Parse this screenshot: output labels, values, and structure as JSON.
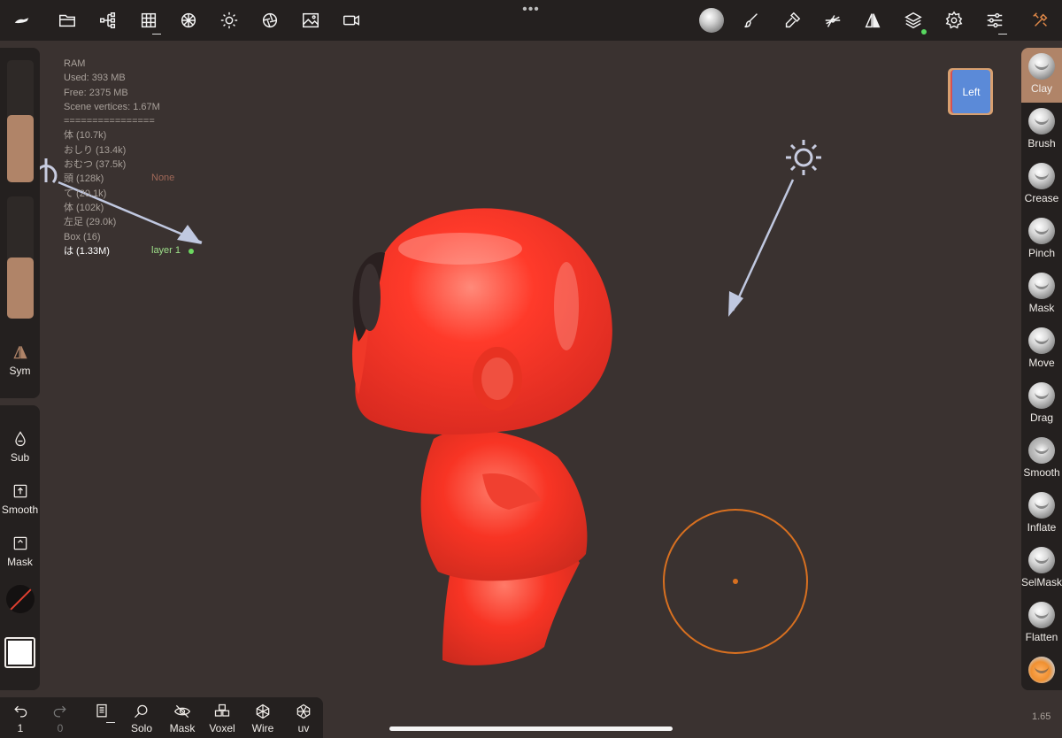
{
  "toolbar": {
    "left_icons": [
      "scene-icon",
      "folder-icon",
      "scene-tree-icon",
      "grid-icon",
      "topology-icon",
      "light-icon",
      "camera-aperture-icon",
      "background-image-icon",
      "video-record-icon"
    ],
    "right_icons": [
      "material-ball-icon",
      "paint-brush-icon",
      "stroke-icon",
      "gizmo-icon",
      "symmetry-icon",
      "layers-icon",
      "settings-icon",
      "tool-settings-icon",
      "interface-icon"
    ],
    "more_dots": "•••"
  },
  "stats": {
    "lines": [
      "RAM",
      "Used: 393 MB",
      "Free: 2375 MB",
      "Scene vertices: 1.67M",
      "================",
      "体 (10.7k)",
      "おしり (13.4k)",
      "おむつ (37.5k)",
      "頭 (128k)",
      "て (20.1k)",
      "体 (102k)",
      "左足 (29.0k)",
      "Box (16)",
      "は (1.33M)"
    ],
    "none_label": "None",
    "layer_label": "layer 1"
  },
  "left_panel": {
    "slider_radius_fill": 0.55,
    "slider_intensity_fill": 0.5,
    "sym_label": "Sym",
    "sub_label": "Sub",
    "smooth_label": "Smooth",
    "mask_label": "Mask"
  },
  "view_cube": {
    "face_label": "Left"
  },
  "tools": [
    {
      "label": "Clay",
      "active": true
    },
    {
      "label": "Brush",
      "active": false
    },
    {
      "label": "Crease",
      "active": false
    },
    {
      "label": "Pinch",
      "active": false
    },
    {
      "label": "Mask",
      "active": false
    },
    {
      "label": "Move",
      "active": false
    },
    {
      "label": "Drag",
      "active": false
    },
    {
      "label": "Smooth",
      "active": false
    },
    {
      "label": "Inflate",
      "active": false
    },
    {
      "label": "SelMask",
      "active": false
    },
    {
      "label": "Flatten",
      "active": false
    }
  ],
  "bottom_bar": {
    "undo_count": "1",
    "redo_count": "0",
    "solo_label": "Solo",
    "mask_label": "Mask",
    "voxel_label": "Voxel",
    "wire_label": "Wire",
    "uv_label": "uv"
  },
  "zoom_value": "1.65",
  "colors": {
    "accent": "#b08468",
    "model": "#ff3a2a",
    "cursor": "#e07020",
    "background": "#3a3230",
    "panel": "#24201f"
  }
}
